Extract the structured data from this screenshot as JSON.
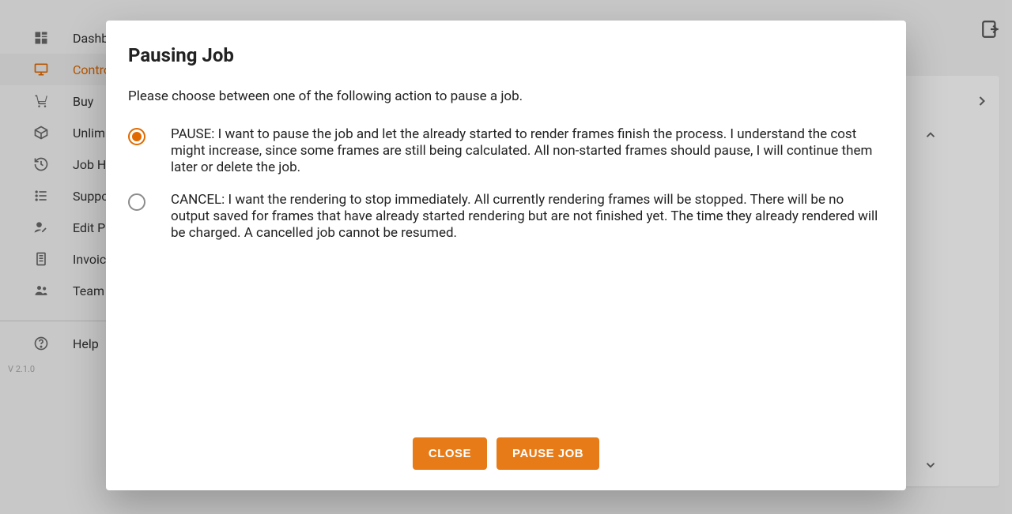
{
  "sidebar": {
    "items": [
      {
        "label": "Dashboard"
      },
      {
        "label": "ControlCenter"
      },
      {
        "label": "Buy"
      },
      {
        "label": "Unlimited Plans"
      },
      {
        "label": "Job History"
      },
      {
        "label": "Support Ticket"
      },
      {
        "label": "Edit Profile"
      },
      {
        "label": "Invoices"
      },
      {
        "label": "Team Management"
      }
    ],
    "help_label": "Help",
    "version": "V 2.1.0"
  },
  "modal": {
    "title": "Pausing Job",
    "subtitle": "Please choose between one of the following action to pause a job.",
    "option_pause": "PAUSE: I want to pause the job and let the already started to render frames finish the process. I understand the cost might increase, since some frames are still being calculated. All non-started frames should pause, I will continue them later or delete the job.",
    "option_cancel": "CANCEL: I want the rendering to stop immediately. All currently rendering frames will be stopped. There will be no output saved for frames that have already started rendering but are not finished yet. The time they already rendered will be charged. A cancelled job cannot be resumed.",
    "selected": "pause",
    "close_label": "CLOSE",
    "confirm_label": "PAUSE JOB"
  }
}
